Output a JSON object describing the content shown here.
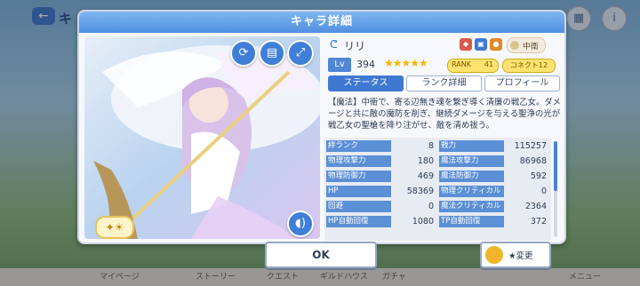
{
  "background": {
    "back_symbol": "←",
    "title_partial": "キ",
    "nav": [
      "マイページ",
      "ストーリー",
      "クエスト",
      "ギルドハウス",
      "ガチャ",
      "メニュー"
    ]
  },
  "dialog": {
    "title": "キャラ詳細",
    "character": {
      "name": "リリ",
      "level_label": "Lv",
      "level": "394",
      "stars": "★★★★★",
      "rank_label": "RANK",
      "rank": "41",
      "connect": "コネクト12",
      "position": "中衛"
    },
    "tabs": [
      {
        "label": "ステータス",
        "active": true
      },
      {
        "label": "ランク詳細",
        "active": false
      },
      {
        "label": "プロフィール",
        "active": false
      }
    ],
    "description": "【魔法】中衛で、寄る辺無き魂を繋ぎ導く清廉の戦乙女。ダメージと共に敵の魔防を削ぎ、継続ダメージを与える聖浄の光が戦乙女の聖槍を降り注がせ、敵を清め祓う。",
    "stats": [
      [
        {
          "label": "絆ランク",
          "value": "8"
        },
        {
          "label": "戦力",
          "value": "115257"
        }
      ],
      [
        {
          "label": "物理攻撃力",
          "value": "180"
        },
        {
          "label": "魔法攻撃力",
          "value": "86968"
        }
      ],
      [
        {
          "label": "物理防御力",
          "value": "469"
        },
        {
          "label": "魔法防御力",
          "value": "592"
        }
      ],
      [
        {
          "label": "HP",
          "value": "58369"
        },
        {
          "label": "物理クリティカル",
          "value": "0"
        }
      ],
      [
        {
          "label": "回避",
          "value": "0"
        },
        {
          "label": "魔法クリティカル",
          "value": "2364"
        }
      ],
      [
        {
          "label": "HP自動回復",
          "value": "1080"
        },
        {
          "label": "TP自動回復",
          "value": "372"
        }
      ]
    ],
    "ok_label": "OK",
    "change_label": "★変更"
  },
  "colors": {
    "header": "#4f8fe0",
    "stat_key": "#5b8fd6",
    "tab_active": "#3f78d0",
    "star": "#f6b400",
    "rank_pill": "#ffe36e"
  },
  "icons": [
    "sync-icon",
    "card-icon",
    "expand-icon",
    "voice-icon",
    "unit-icon",
    "class-icon",
    "position-icon"
  ]
}
